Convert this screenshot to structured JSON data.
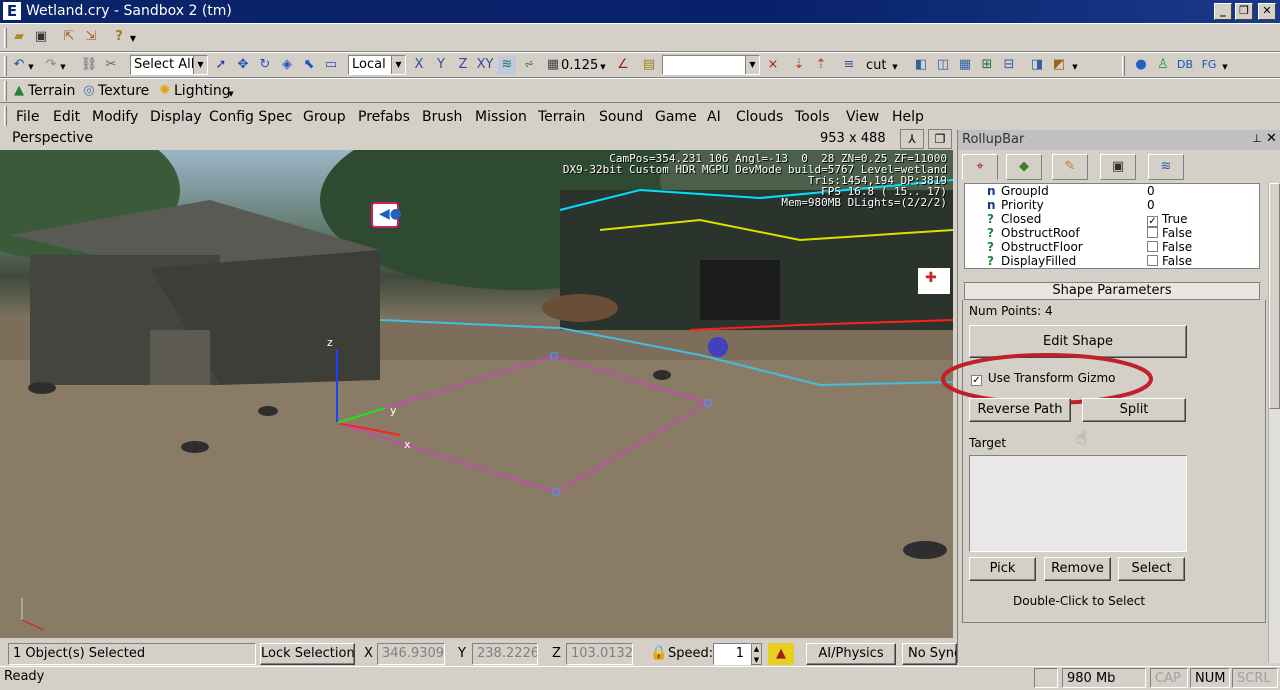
{
  "window": {
    "title": "Wetland.cry - Sandbox 2 (tm)",
    "app_icon": "E",
    "minimize": "_",
    "restore": "❐",
    "close": "✕"
  },
  "toolbar1": {
    "icons": [
      "open-icon",
      "save-icon",
      "export-icon",
      "import-icon",
      "help-icon"
    ]
  },
  "toolbar2": {
    "select_combo": "Select All",
    "coord_combo": "Local",
    "axis_x": "X",
    "axis_y": "Y",
    "axis_z": "Z",
    "axis_xy": "XY",
    "grid_value": "0.125",
    "layer_combo": "",
    "cut_label": "cut"
  },
  "toolbar3": {
    "db_label": "DB",
    "fg_label": "FG"
  },
  "toolbar4": {
    "terrain_label": "Terrain",
    "texture_label": "Texture",
    "lighting_label": "Lighting"
  },
  "menu": [
    "File",
    "Edit",
    "Modify",
    "Display",
    "Config Spec",
    "Group",
    "Prefabs",
    "Brush",
    "Mission",
    "Terrain",
    "Sound",
    "Game",
    "AI",
    "Clouds",
    "Tools",
    "View",
    "Help"
  ],
  "viewport": {
    "label": "Perspective",
    "size": "953 x 488",
    "osd_line1": "CamPos=354.231 106 Angl=-13  0  28 ZN=0.25 ZF=11000",
    "osd_line2": "DX9-32bit Custom HDR MGPU DevMode build=5767 Level=wetland",
    "osd_line3": "Tris:1454,194 DP:3819",
    "osd_line4": "FPS 16.8 ( 15.. 17)",
    "osd_line5": "Mem=980MB DLights=(2/2/2)",
    "axis_x": "x",
    "axis_y": "y",
    "axis_z": "z"
  },
  "rollup": {
    "title": "RollupBar",
    "pin": "📌",
    "close": "✕",
    "tabs": [
      "create-tab",
      "terrain-tab",
      "modify-tab",
      "display-tab",
      "layers-tab"
    ],
    "properties": [
      {
        "type": "n",
        "name": "GroupId",
        "value": "0",
        "checkbox": false,
        "checked": false
      },
      {
        "type": "n",
        "name": "Priority",
        "value": "0",
        "checkbox": false,
        "checked": false
      },
      {
        "type": "?",
        "name": "Closed",
        "value": "True",
        "checkbox": true,
        "checked": true
      },
      {
        "type": "?",
        "name": "ObstructRoof",
        "value": "False",
        "checkbox": true,
        "checked": false
      },
      {
        "type": "?",
        "name": "ObstructFloor",
        "value": "False",
        "checkbox": true,
        "checked": false
      },
      {
        "type": "?",
        "name": "DisplayFilled",
        "value": "False",
        "checkbox": true,
        "checked": false
      }
    ],
    "shape_params_title": "Shape Parameters",
    "num_points": "Num Points: 4",
    "edit_shape": "Edit Shape",
    "use_transform_gizmo": "Use Transform Gizmo",
    "use_transform_gizmo_checked": true,
    "reverse_path": "Reverse Path",
    "split": "Split",
    "target_label": "Target",
    "pick": "Pick",
    "remove": "Remove",
    "select": "Select",
    "double_click_hint": "Double-Click to Select"
  },
  "status": {
    "selected": "1 Object(s) Selected",
    "lock_selection": "Lock Selection",
    "x_label": "X",
    "x_value": "346.9309",
    "y_label": "Y",
    "y_value": "238.2226",
    "z_label": "Z",
    "z_value": "103.0132",
    "speed_label": "Speed:",
    "speed_value": "1",
    "ai_physics": "AI/Physics",
    "no_sync": "No Sync"
  },
  "readybar": {
    "ready": "Ready",
    "memory": "980 Mb",
    "cap": "CAP",
    "num": "NUM",
    "scrl": "SCRL"
  },
  "colors": {
    "titlebar": "#0a246a",
    "highlight_circle": "#c0202a",
    "shape_outline": "#d040c0"
  }
}
